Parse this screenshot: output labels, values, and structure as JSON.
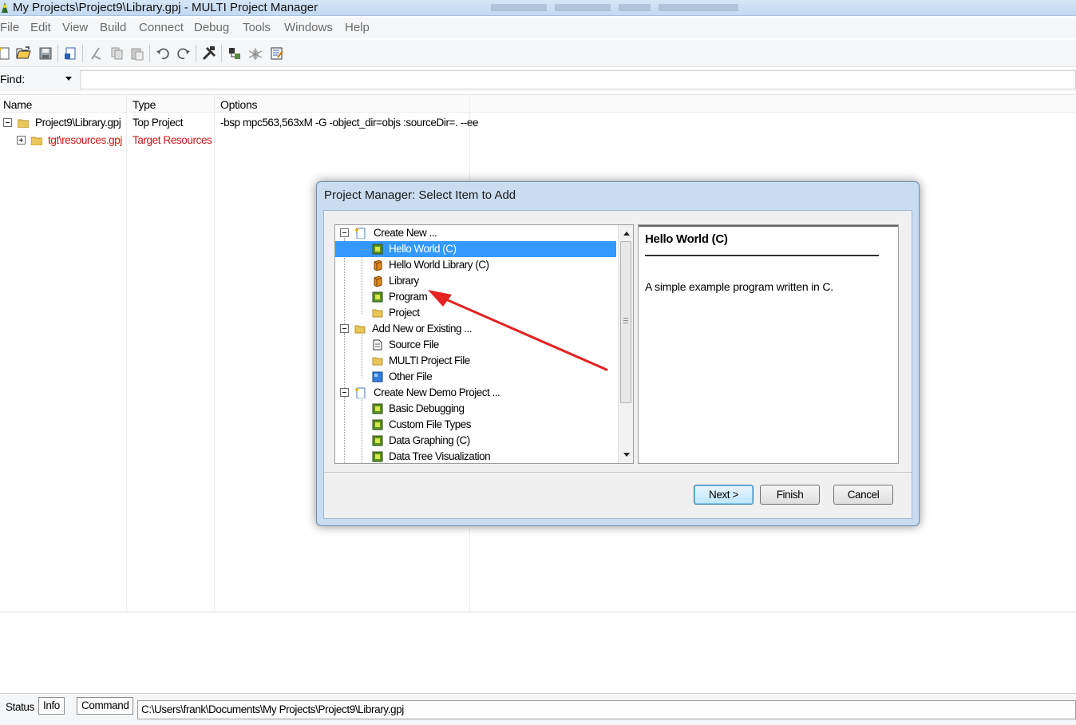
{
  "window": {
    "title": "My Projects\\Project9\\Library.gpj - MULTI Project Manager"
  },
  "menu": [
    "File",
    "Edit",
    "View",
    "Build",
    "Connect",
    "Debug",
    "Tools",
    "Windows",
    "Help"
  ],
  "toolbar": {
    "buttons": [
      "new-icon",
      "open-icon",
      "save-icon",
      "add-file-icon",
      "cut-icon",
      "copy-icon",
      "paste-icon",
      "undo-icon",
      "redo-icon",
      "build-icon",
      "connect-icon",
      "debug-icon",
      "editor-icon"
    ]
  },
  "find": {
    "label": "Find:",
    "value": ""
  },
  "project_table": {
    "columns": [
      "Name",
      "Type",
      "Options"
    ],
    "rows": [
      {
        "name": "Project9\\Library.gpj",
        "type": "Top Project",
        "options": "-bsp mpc563,563xM -G -object_dir=objs :sourceDir=. --ee",
        "color": "#000000"
      },
      {
        "name": "tgt\\resources.gpj",
        "type": "Target Resources",
        "options": "",
        "color": "#d11616"
      }
    ]
  },
  "dialog": {
    "title": "Project Manager: Select Item to Add",
    "items": [
      {
        "label": "Create New ...",
        "level": 0,
        "icon": "new-document-icon"
      },
      {
        "label": "Hello World (C)",
        "level": 1,
        "icon": "program-icon",
        "selected": true
      },
      {
        "label": "Hello World Library (C)",
        "level": 1,
        "icon": "library-icon"
      },
      {
        "label": "Library",
        "level": 1,
        "icon": "library-icon"
      },
      {
        "label": "Program",
        "level": 1,
        "icon": "program-icon"
      },
      {
        "label": "Project",
        "level": 1,
        "icon": "folder-icon"
      },
      {
        "label": "Add New or Existing ...",
        "level": 0,
        "icon": "folder-icon"
      },
      {
        "label": "Source File",
        "level": 1,
        "icon": "source-file-icon"
      },
      {
        "label": "MULTI Project File",
        "level": 1,
        "icon": "folder-icon"
      },
      {
        "label": "Other File",
        "level": 1,
        "icon": "other-file-icon"
      },
      {
        "label": "Create New Demo Project ...",
        "level": 0,
        "icon": "new-document-icon"
      },
      {
        "label": "Basic Debugging",
        "level": 1,
        "icon": "program-icon"
      },
      {
        "label": "Custom File Types",
        "level": 1,
        "icon": "program-icon"
      },
      {
        "label": "Data Graphing (C)",
        "level": 1,
        "icon": "program-icon"
      },
      {
        "label": "Data Tree Visualization",
        "level": 1,
        "icon": "program-icon"
      }
    ],
    "description": {
      "title": "Hello World (C)",
      "text": "A simple example program written in C."
    },
    "buttons": {
      "next": "Next >",
      "finish": "Finish",
      "cancel": "Cancel"
    }
  },
  "status": {
    "tabs": [
      "Status",
      "Info",
      "Command"
    ],
    "path": "C:\\Users\\frank\\Documents\\My Projects\\Project9\\Library.gpj"
  },
  "colors": {
    "selection": "#3399ff",
    "annotation_arrow": "#e32222",
    "dialog_frame": "#c9dcf0"
  }
}
